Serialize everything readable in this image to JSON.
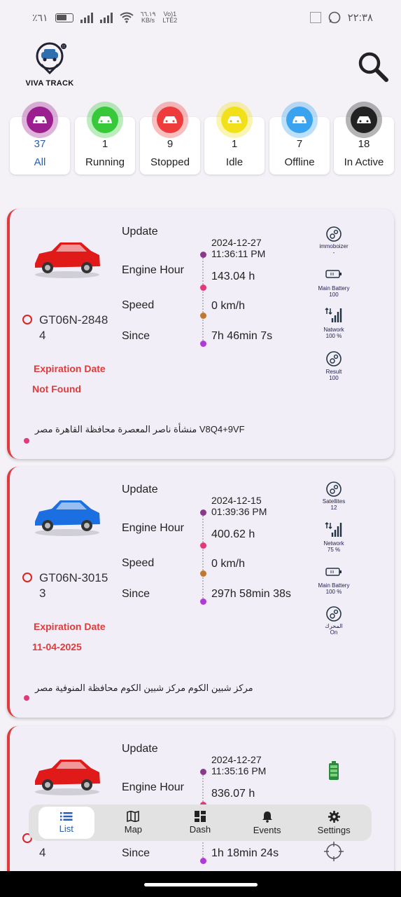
{
  "status_bar": {
    "battery_text": "٪٦١",
    "speed": "٦٦.١٩",
    "speed_unit": "KB/s",
    "network_top": "Vo)1",
    "network_bottom": "LTE2",
    "time": "٢٢:٣٨"
  },
  "header": {
    "logo_text": "VIVA TRACK"
  },
  "filters": [
    {
      "label": "All",
      "count": "37",
      "color": "#9c1f8f",
      "active": true
    },
    {
      "label": "Running",
      "count": "1",
      "color": "#37c93a"
    },
    {
      "label": "Stopped",
      "count": "9",
      "color": "#ee3b3b"
    },
    {
      "label": "Idle",
      "count": "1",
      "color": "#f2e11a"
    },
    {
      "label": "Offline",
      "count": "7",
      "color": "#3aa3ef"
    },
    {
      "label": "In Active",
      "count": "18",
      "color": "#222222"
    }
  ],
  "field_labels": {
    "update": "Update",
    "engine_hour": "Engine Hour",
    "speed": "Speed",
    "since": "Since"
  },
  "cards": [
    {
      "plate": "GT06N-28484",
      "car_color": "#e01919",
      "expiration_label": "Expiration Date",
      "expiration_value": "Not Found",
      "update_date": "2024-12-27",
      "update_time": "11:36:11 PM",
      "engine_hour": "143.04 h",
      "speed": "0 km/h",
      "since": "7h 46min 7s",
      "address": "منشأة ناصر المعصرة محافظة القاهرة مصر V8Q4+9VF",
      "right": [
        {
          "label": "immoboizer",
          "value": "-",
          "icon": "lock-dial-icon"
        },
        {
          "label": "Main Battery",
          "value": "100",
          "icon": "battery-icon"
        },
        {
          "label": "Natwork",
          "value": "100 %",
          "icon": "signal-icon"
        },
        {
          "label": "Result",
          "value": "100",
          "icon": "dial-icon"
        }
      ]
    },
    {
      "plate": "GT06N-30153",
      "car_color": "#1c6fe0",
      "expiration_label": "Expiration Date",
      "expiration_value": "11-04-2025",
      "update_date": "2024-12-15",
      "update_time": "01:39:36 PM",
      "engine_hour": "400.62 h",
      "speed": "0 km/h",
      "since": "297h 58min 38s",
      "address": "مركز شبين الكوم  مركز شبين الكوم محافظة المنوفية مصر",
      "right": [
        {
          "label": "Satellites",
          "value": "12",
          "icon": "satellite-dial-icon"
        },
        {
          "label": "Network",
          "value": "75 %",
          "icon": "signal-icon"
        },
        {
          "label": "Main Battery",
          "value": "100 %",
          "icon": "battery-icon"
        },
        {
          "label": "المحرك",
          "value": "On",
          "icon": "engine-dial-icon"
        }
      ]
    },
    {
      "plate": "4",
      "car_color": "#e01919",
      "update_date": "2024-12-27",
      "update_time": "11:35:16 PM",
      "engine_hour": "836.07 h",
      "since": "1h 18min 24s"
    }
  ],
  "nav": [
    {
      "label": "List",
      "icon": "list-icon",
      "active": true
    },
    {
      "label": "Map",
      "icon": "map-icon"
    },
    {
      "label": "Dash",
      "icon": "dashboard-icon"
    },
    {
      "label": "Events",
      "icon": "bell-icon"
    },
    {
      "label": "Settings",
      "icon": "gear-icon"
    }
  ]
}
